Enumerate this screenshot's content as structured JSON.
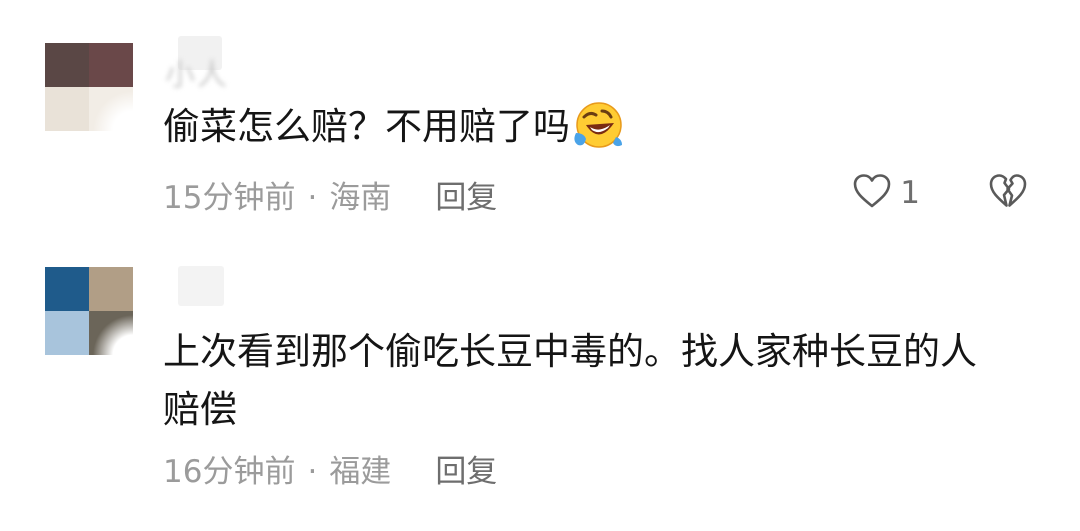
{
  "comments": [
    {
      "username": "小人",
      "content": "偷菜怎么赔？不用赔了吗",
      "emoji": "rolling-on-floor-laughing-emoji",
      "time": "15分钟前",
      "separator": "·",
      "location": "海南",
      "reply_label": "回复",
      "like_count": "1",
      "avatar_colors": [
        "#5a4745",
        "#6a4849",
        "#e9e2d8",
        "#f2ede6"
      ]
    },
    {
      "username": "",
      "content_line1": "上次看到那个偷吃长豆中毒的。找人家种长豆的人",
      "content_line2": "赔偿",
      "time": "16分钟前",
      "separator": "·",
      "location": "福建",
      "reply_label": "回复",
      "avatar_colors": [
        "#1f5b8b",
        "#b19e86",
        "#a8c4dc",
        "#6b6559"
      ]
    }
  ]
}
